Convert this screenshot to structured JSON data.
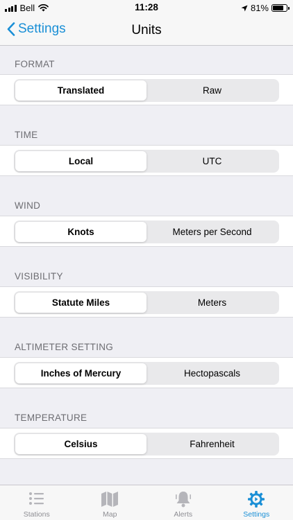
{
  "status_bar": {
    "carrier": "Bell",
    "time": "11:28",
    "battery": "81%",
    "battery_level": 0.81
  },
  "nav": {
    "back_label": "Settings",
    "title": "Units"
  },
  "sections": [
    {
      "header": "FORMAT",
      "options": [
        "Translated",
        "Raw"
      ],
      "selected": 0
    },
    {
      "header": "TIME",
      "options": [
        "Local",
        "UTC"
      ],
      "selected": 0
    },
    {
      "header": "WIND",
      "options": [
        "Knots",
        "Meters per Second"
      ],
      "selected": 0
    },
    {
      "header": "VISIBILITY",
      "options": [
        "Statute Miles",
        "Meters"
      ],
      "selected": 0
    },
    {
      "header": "ALTIMETER SETTING",
      "options": [
        "Inches of Mercury",
        "Hectopascals"
      ],
      "selected": 0
    },
    {
      "header": "TEMPERATURE",
      "options": [
        "Celsius",
        "Fahrenheit"
      ],
      "selected": 0
    }
  ],
  "tab_bar": {
    "items": [
      {
        "label": "Stations",
        "icon": "list-icon"
      },
      {
        "label": "Map",
        "icon": "map-icon"
      },
      {
        "label": "Alerts",
        "icon": "bell-icon"
      },
      {
        "label": "Settings",
        "icon": "gear-icon"
      }
    ],
    "active": 3
  },
  "colors": {
    "accent": "#1a8fd6",
    "background": "#efeff4",
    "inactive_tab": "#b5b5ba"
  }
}
